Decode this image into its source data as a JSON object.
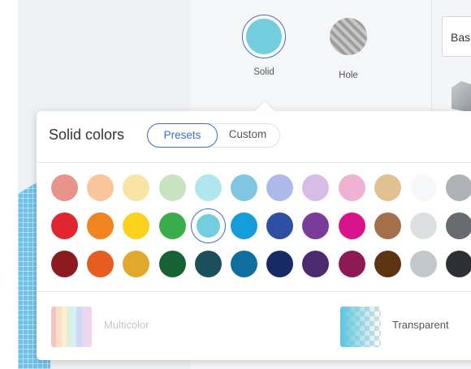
{
  "type_selector": {
    "solid_label": "Solid",
    "hole_label": "Hole"
  },
  "side_panel": {
    "base_field_text": "Bas"
  },
  "popover": {
    "title": "Solid colors",
    "tabs": {
      "presets": "Presets",
      "custom": "Custom"
    },
    "active_tab": "presets",
    "swatch_rows": [
      [
        "#e8948a",
        "#f9c59c",
        "#fae3a7",
        "#c7e3bf",
        "#b2e6ee",
        "#7fc6e3",
        "#aeb9ea",
        "#d5bde8",
        "#efb2d3",
        "#e0c290",
        "#f7f8f9",
        "#aeb2b6"
      ],
      [
        "#e0262f",
        "#f18320",
        "#f8d21c",
        "#3cab4a",
        "#72cddd",
        "#149dd8",
        "#2e4fa2",
        "#7b3b98",
        "#d8148c",
        "#a4704b",
        "#dde0e3",
        "#686c70"
      ],
      [
        "#8c1a20",
        "#e55e20",
        "#e0a92e",
        "#176235",
        "#1b4f5b",
        "#0f6e9d",
        "#172a63",
        "#4d2a6e",
        "#8d1a54",
        "#5c3412",
        "#c2c7cc",
        "#2c2f33"
      ]
    ],
    "selected_swatch": {
      "row": 1,
      "col": 4
    },
    "multicolor_label": "Multicolor",
    "multicolor_stripes": [
      "#e8948a",
      "#f9c59c",
      "#fae3a7",
      "#c7e3bf",
      "#b2e6ee",
      "#aeb9ea",
      "#d5bde8",
      "#efb2d3"
    ],
    "transparent_label": "Transparent"
  },
  "colors": {
    "accent": "#3b6fc9"
  }
}
